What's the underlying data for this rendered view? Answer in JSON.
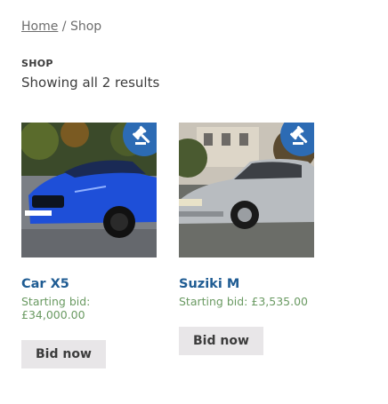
{
  "breadcrumb": {
    "home": "Home",
    "separator": " / ",
    "current": "Shop"
  },
  "page": {
    "label": "SHOP",
    "result_count": "Showing all 2 results"
  },
  "products": [
    {
      "title": "Car X5",
      "price": "Starting bid: £34,000.00",
      "button": "Bid now",
      "badge_icon": "gavel-icon",
      "car_color": "#1e4fd8"
    },
    {
      "title": "Suziki M",
      "price": "Starting bid: £3,535.00",
      "button": "Bid now",
      "badge_icon": "gavel-icon",
      "car_color": "#b8bcc0"
    }
  ],
  "colors": {
    "accent": "#2c6bb4",
    "title": "#1f5c93",
    "price": "#6a9a62",
    "button_bg": "#e8e6e8"
  }
}
